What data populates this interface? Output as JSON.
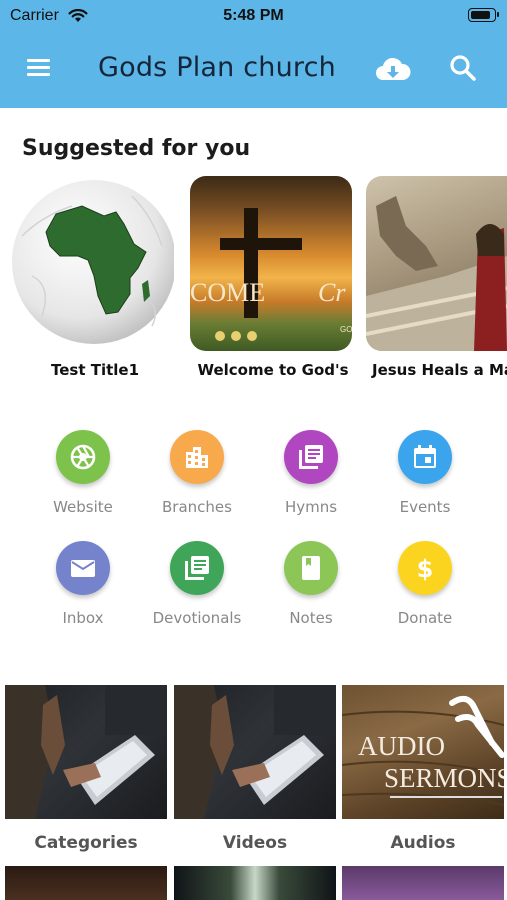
{
  "status": {
    "carrier": "Carrier",
    "time": "5:48 PM",
    "battery_level": 0.92
  },
  "appbar": {
    "title": "Gods Plan church",
    "menu_icon": "menu-icon",
    "cloud_icon": "cloud-download-icon",
    "search_icon": "search-icon",
    "color": "#5cb6e8"
  },
  "suggested": {
    "title": "Suggested for you",
    "items": [
      {
        "label": "Test Title1"
      },
      {
        "label": "Welcome to God's",
        "image_text": [
          "COME",
          "Cr",
          "GO"
        ]
      },
      {
        "label": "Jesus Heals a Ma"
      }
    ]
  },
  "quick_links": [
    {
      "label": "Website",
      "icon": "aperture-icon",
      "color": "#7dc24b"
    },
    {
      "label": "Branches",
      "icon": "building-icon",
      "color": "#f8a94c"
    },
    {
      "label": "Hymns",
      "icon": "library-books-icon",
      "color": "#b047c1"
    },
    {
      "label": "Events",
      "icon": "calendar-icon",
      "color": "#3aa4ec"
    },
    {
      "label": "Inbox",
      "icon": "mail-icon",
      "color": "#7583cc"
    },
    {
      "label": "Devotionals",
      "icon": "library-books-icon",
      "color": "#3fa659"
    },
    {
      "label": "Notes",
      "icon": "book-icon",
      "color": "#8cc657"
    },
    {
      "label": "Donate",
      "icon": "dollar-icon",
      "color": "#fbd420"
    }
  ],
  "media": {
    "tiles": [
      {
        "label": "Categories"
      },
      {
        "label": "Videos"
      },
      {
        "label": "Audios",
        "image_text": [
          "AUDIO",
          "SERMONS"
        ]
      }
    ]
  }
}
